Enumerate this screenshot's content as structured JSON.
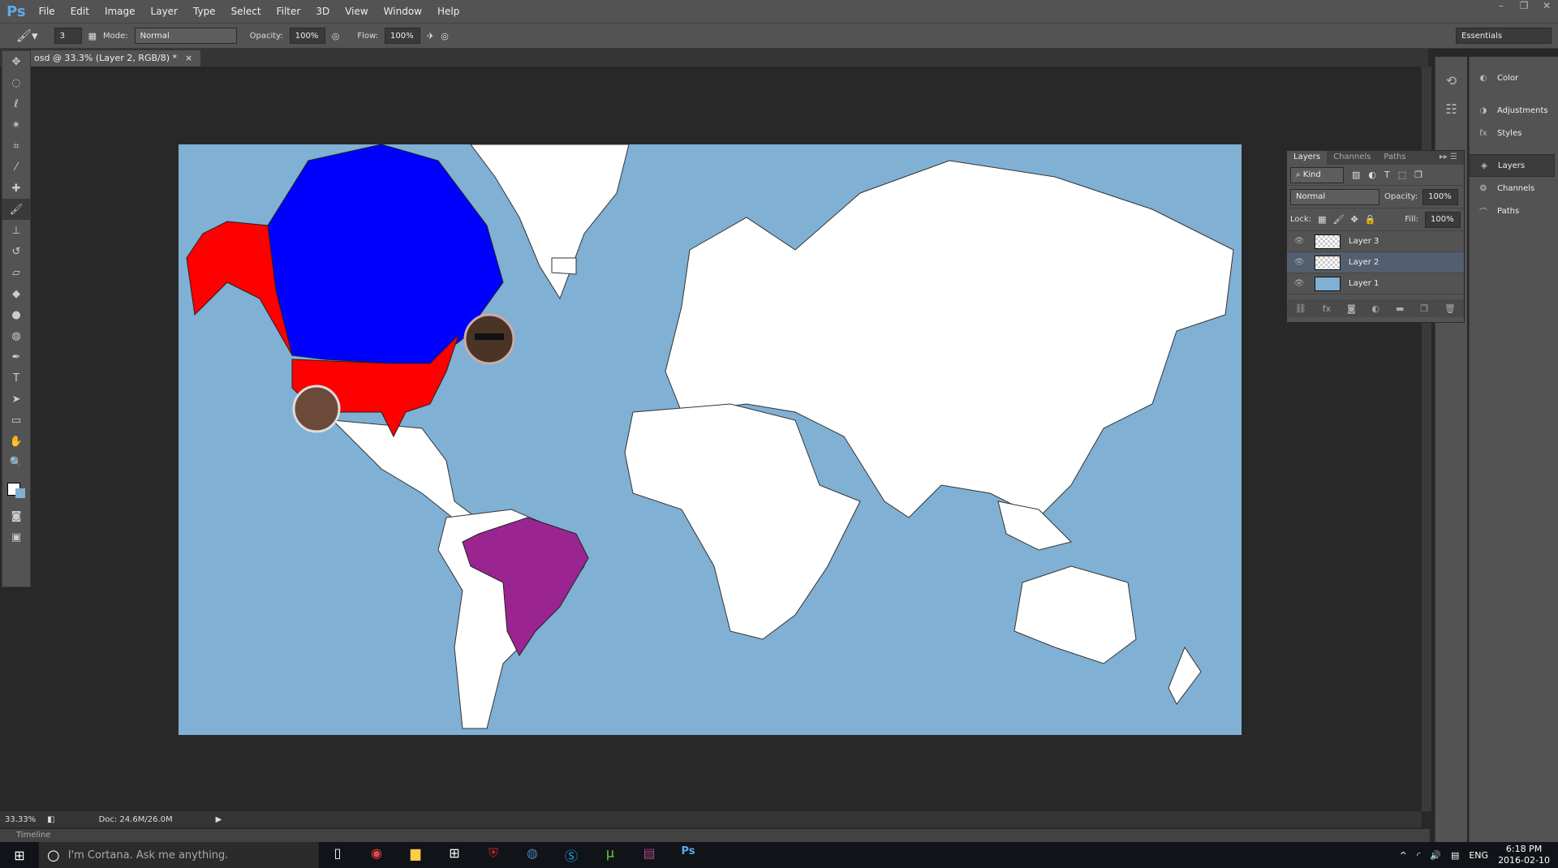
{
  "app": {
    "logo": "Ps",
    "menu": [
      "File",
      "Edit",
      "Image",
      "Layer",
      "Type",
      "Select",
      "Filter",
      "3D",
      "View",
      "Window",
      "Help"
    ],
    "window_controls": [
      "–",
      "❐",
      "✕"
    ]
  },
  "options": {
    "brush_size": "3",
    "mode_label": "Mode:",
    "mode": "Normal",
    "opacity_label": "Opacity:",
    "opacity": "100%",
    "flow_label": "Flow:",
    "flow": "100%",
    "workspace": "Essentials"
  },
  "document": {
    "tab_title": "osd @ 33.3% (Layer 2, RGB/8) *",
    "close": "×"
  },
  "tools": [
    "move",
    "marquee",
    "lasso",
    "magic-wand",
    "crop",
    "eyedropper",
    "healing",
    "brush",
    "stamp",
    "history-brush",
    "eraser",
    "paint-bucket",
    "blur",
    "dodge",
    "pen",
    "type",
    "path-select",
    "rectangle",
    "hand",
    "zoom"
  ],
  "map": {
    "ocean": "#80b0d4",
    "land": "#ffffff",
    "canada": "#0000ff",
    "usa_alaska": "#ff0000",
    "brazil": "#9b2590"
  },
  "dock": {
    "items": [
      {
        "label": "Color",
        "icon": "color-icon"
      },
      {
        "label": "Adjustments",
        "icon": "adjustments-icon"
      },
      {
        "label": "Styles",
        "icon": "styles-icon"
      },
      {
        "label": "Layers",
        "icon": "layers-icon",
        "selected": true
      },
      {
        "label": "Channels",
        "icon": "channels-icon"
      },
      {
        "label": "Paths",
        "icon": "paths-icon"
      }
    ]
  },
  "layers_panel": {
    "tabs": [
      "Layers",
      "Channels",
      "Paths"
    ],
    "filter": "Kind",
    "blend": "Normal",
    "opacity_label": "Opacity:",
    "opacity": "100%",
    "lock_label": "Lock:",
    "fill_label": "Fill:",
    "fill": "100%",
    "layers": [
      {
        "name": "Layer 3"
      },
      {
        "name": "Layer 2",
        "selected": true
      },
      {
        "name": "Layer 1"
      }
    ]
  },
  "status": {
    "zoom": "33.33%",
    "doc": "Doc: 24.6M/26.0M"
  },
  "timeline": "Timeline",
  "taskbar": {
    "search": "I'm Cortana. Ask me anything.",
    "apps": [
      "task-view",
      "chrome",
      "file-explorer",
      "store",
      "mcafee",
      "steam",
      "skype",
      "utorrent",
      "winrar",
      "photoshop"
    ],
    "lang": "ENG",
    "time": "6:18 PM",
    "date": "2016-02-10"
  }
}
